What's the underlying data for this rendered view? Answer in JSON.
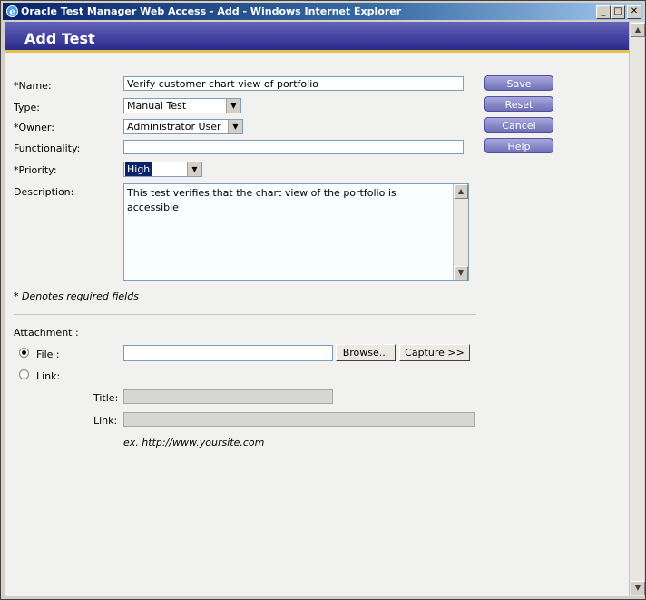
{
  "window": {
    "title": "Oracle Test Manager Web Access - Add - Windows Internet Explorer",
    "minimize": "_",
    "maximize": "□",
    "close": "✕"
  },
  "header": {
    "title": "Add Test"
  },
  "form": {
    "name": {
      "label": "*Name:",
      "value": "Verify customer chart view of portfolio"
    },
    "type": {
      "label": "Type:",
      "value": "Manual Test"
    },
    "owner": {
      "label": "*Owner:",
      "value": "Administrator User"
    },
    "functionality": {
      "label": "Functionality:",
      "value": ""
    },
    "priority": {
      "label": "*Priority:",
      "value": "High"
    },
    "description": {
      "label": "Description:",
      "value": "This test verifies that the chart view of the portfolio is accessible"
    },
    "required_note": "* Denotes required fields"
  },
  "actions": {
    "save": "Save",
    "reset": "Reset",
    "cancel": "Cancel",
    "help": "Help"
  },
  "attachment": {
    "label": "Attachment :",
    "file_label": "File :",
    "link_label": "Link:",
    "file_value": "",
    "browse": "Browse...",
    "capture": "Capture >>",
    "title_label": "Title:",
    "link_field_label": "Link:",
    "example": "ex. http://www.yoursite.com",
    "selected": "file"
  },
  "colors": {
    "header": "#2a2a8c",
    "header_stripe": "#e2c24a",
    "button": "#7070b8"
  }
}
